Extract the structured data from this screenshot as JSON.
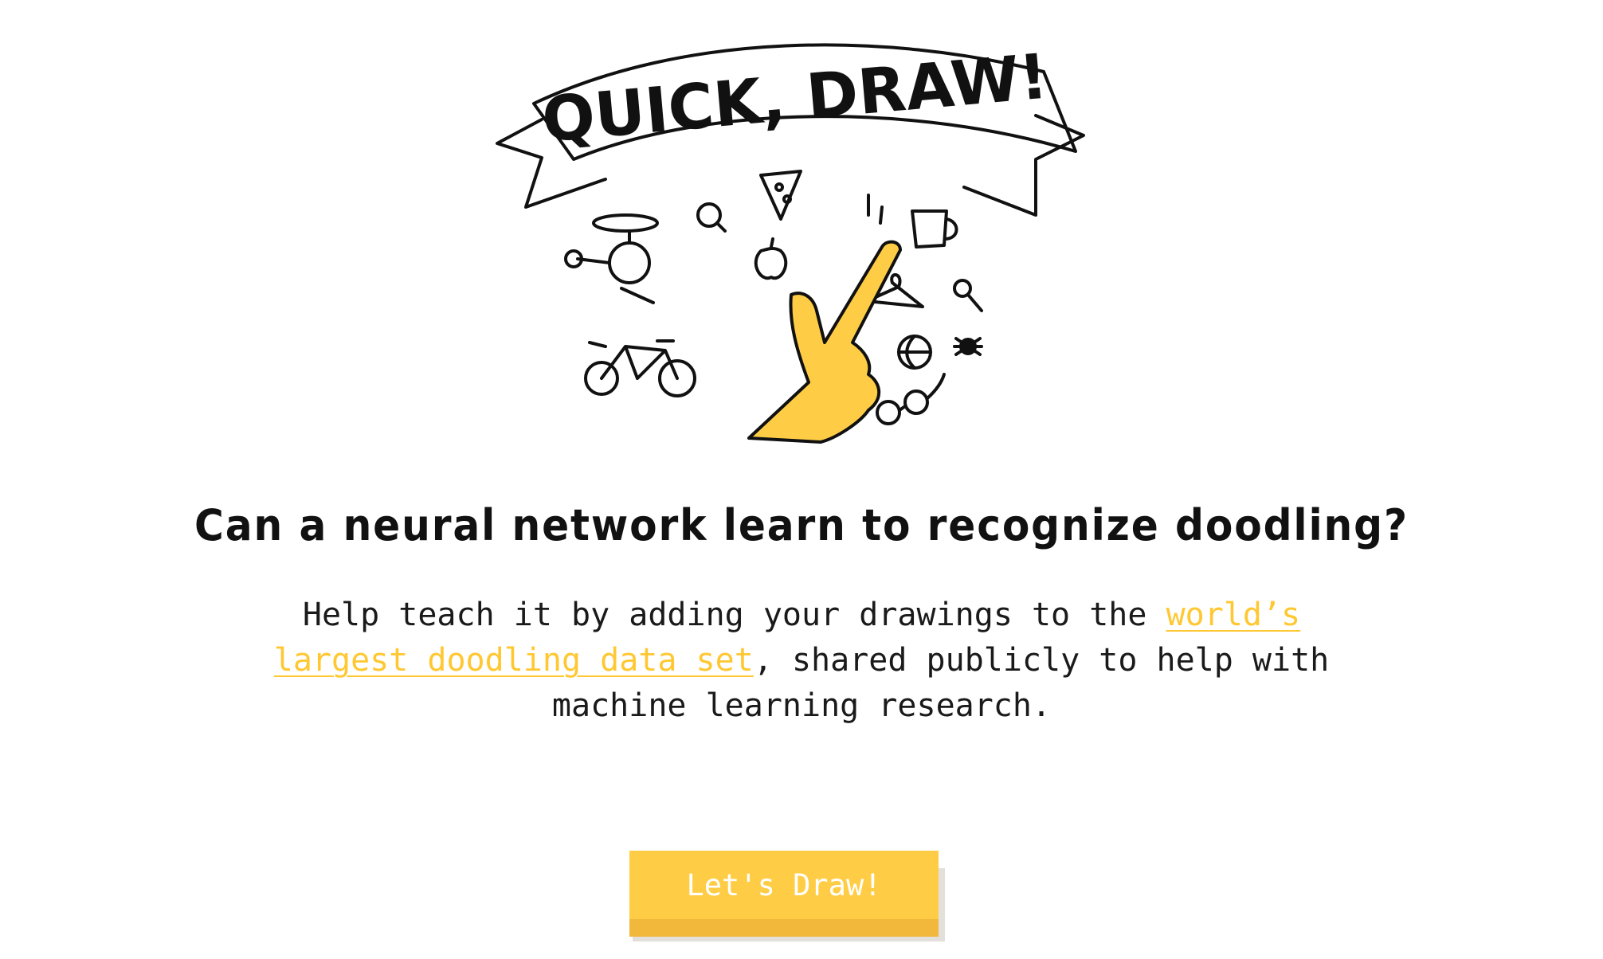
{
  "logo": {
    "text": "QUICK, DRAW!"
  },
  "headline": "Can a neural network learn to recognize doodling?",
  "description": {
    "before_link": "Help teach it by adding your drawings to the ",
    "link_text": "world’s largest doodling data set",
    "after_link": ", shared publicly to help with machine learning research."
  },
  "cta": {
    "label": "Let's Draw!"
  },
  "colors": {
    "accent": "#ffcd45",
    "accent_dark": "#f1b83c",
    "link": "#ffc832",
    "text": "#111111"
  },
  "doodles": [
    "helicopter-icon",
    "lightbulb-icon",
    "pizza-icon",
    "apple-icon",
    "mug-icon",
    "hanger-icon",
    "pushpin-icon",
    "bicycle-icon",
    "basketball-icon",
    "spider-icon",
    "eyeglasses-icon",
    "pointing-hand-icon"
  ]
}
